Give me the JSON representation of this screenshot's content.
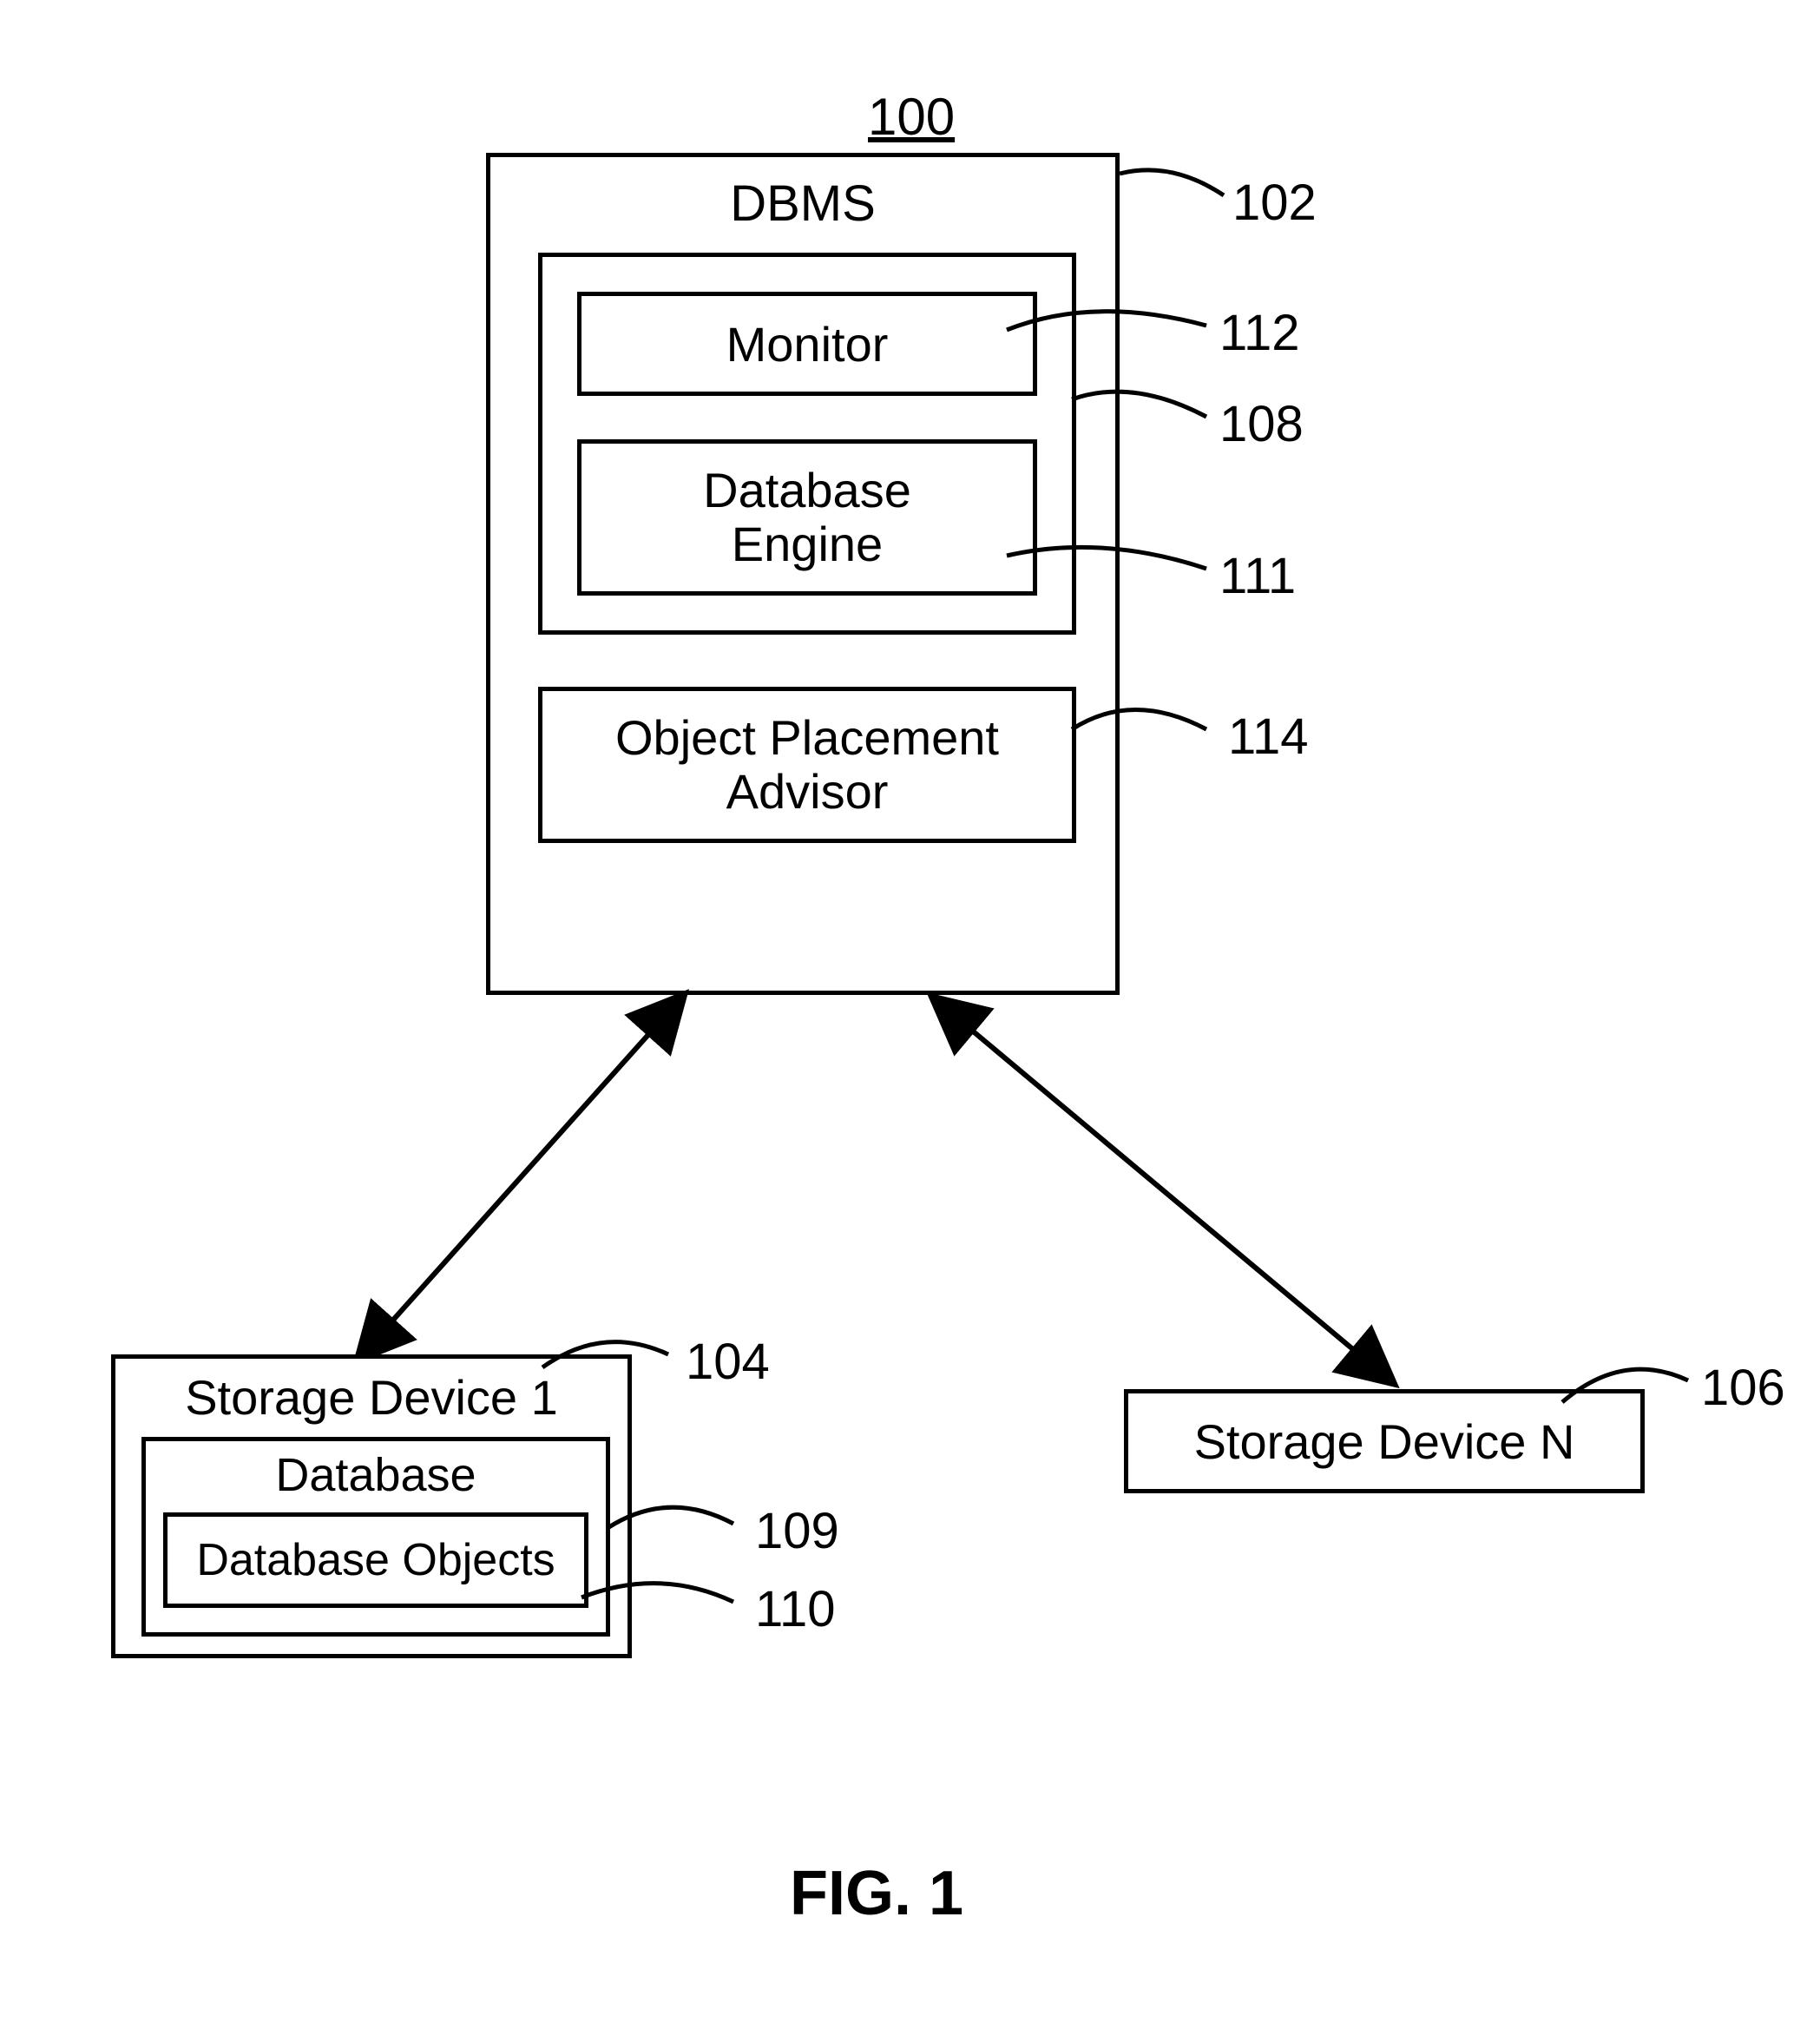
{
  "figure_number": "100",
  "dbms": {
    "title": "DBMS",
    "ref": "102",
    "group_ref": "108",
    "monitor": {
      "label": "Monitor",
      "ref": "112"
    },
    "engine": {
      "label": "Database\nEngine",
      "ref": "111"
    },
    "advisor": {
      "label": "Object Placement\nAdvisor",
      "ref": "114"
    }
  },
  "storage1": {
    "title": "Storage Device 1",
    "ref": "104",
    "database": {
      "label": "Database",
      "ref": "109"
    },
    "objects": {
      "label": "Database Objects",
      "ref": "110"
    }
  },
  "storageN": {
    "title": "Storage Device N",
    "ref": "106"
  },
  "caption": "FIG. 1"
}
